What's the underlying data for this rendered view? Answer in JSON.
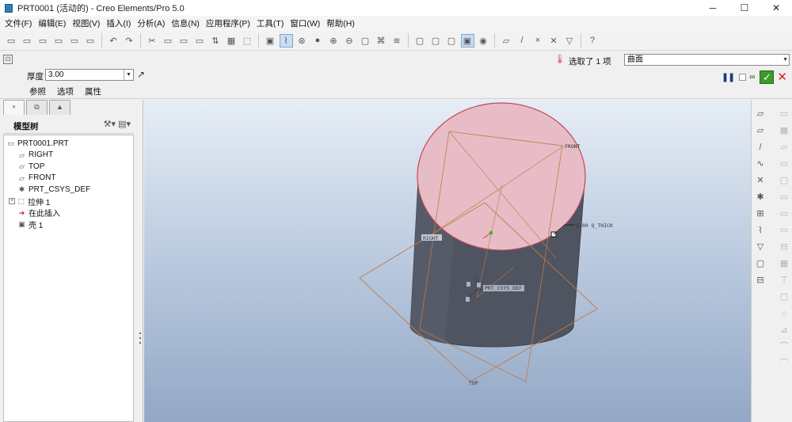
{
  "window": {
    "title": "PRT0001 (活动的) - Creo Elements/Pro 5.0",
    "minimize": "─",
    "maximize": "☐",
    "close": "✕"
  },
  "menu": [
    "文件(F)",
    "编辑(E)",
    "视图(V)",
    "插入(I)",
    "分析(A)",
    "信息(N)",
    "应用程序(P)",
    "工具(T)",
    "窗口(W)",
    "帮助(H)"
  ],
  "toolbar": {
    "icons": [
      "new-icon",
      "open-icon",
      "save-icon",
      "print-icon",
      "email-icon",
      "send-icon",
      "sep",
      "undo-icon",
      "redo-icon",
      "sep",
      "cut-icon",
      "copy-icon",
      "paste-icon",
      "paste-special-icon",
      "regenerate-icon",
      "find-icon",
      "select-box-icon",
      "sep",
      "datum-display-icon",
      "datum-axis-icon",
      "spin-center-icon",
      "appearance-icon",
      "zoom-in-icon",
      "zoom-out-icon",
      "refit-icon",
      "saved-views-icon",
      "layers-icon",
      "sep",
      "wireframe-icon",
      "hidden-line-icon",
      "no-hidden-icon",
      "shading-icon",
      "realtime-render-icon",
      "sep",
      "plane-display-icon",
      "axis-display-icon",
      "point-display-icon",
      "csys-display-icon",
      "annotation-display-icon",
      "sep",
      "context-help-icon"
    ],
    "glyphs": [
      "▭",
      "▭",
      "▭",
      "▭",
      "▭",
      "▭",
      "",
      "↶",
      "↷",
      "",
      "✂",
      "▭",
      "▭",
      "▭",
      "⇅",
      "▦",
      "⬚",
      "",
      "▣",
      "⌇",
      "⊛",
      "●",
      "⊕",
      "⊖",
      "▢",
      "⌘",
      "≋",
      "",
      "▢",
      "▢",
      "▢",
      "▣",
      "◉",
      "",
      "▱",
      "/",
      "×",
      "✕",
      "▽",
      "",
      "?"
    ]
  },
  "dashboard": {
    "thickness_label": "厚度",
    "thickness_value": "3.00",
    "flip": "↗",
    "tabs": [
      "参照",
      "选项",
      "属性"
    ],
    "selection_text": "选取了 1 项",
    "filter_value": "曲面",
    "pause": "❚❚",
    "glasses": "∞",
    "ok": "✓",
    "cancel": "✕"
  },
  "left_panel": {
    "tab_glyphs": [
      "⚬",
      "⧉",
      "▲"
    ],
    "tree_title": "模型树",
    "tree_tools": "⚒▾ ▤▾",
    "items": [
      {
        "label": "PRT0001.PRT",
        "glyph": "▭",
        "icon": "part-icon"
      },
      {
        "label": "RIGHT",
        "glyph": "▱",
        "icon": "datum-plane-icon"
      },
      {
        "label": "TOP",
        "glyph": "▱",
        "icon": "datum-plane-icon"
      },
      {
        "label": "FRONT",
        "glyph": "▱",
        "icon": "datum-plane-icon"
      },
      {
        "label": "PRT_CSYS_DEF",
        "glyph": "✱",
        "icon": "csys-icon"
      },
      {
        "label": "拉伸 1",
        "glyph": "⬚",
        "icon": "extrude-icon",
        "expandable": true
      },
      {
        "label": "在此插入",
        "glyph": "➔",
        "icon": "insert-here-icon"
      },
      {
        "label": "壳 1",
        "glyph": "▣",
        "icon": "shell-icon"
      }
    ]
  },
  "viewport": {
    "labels": {
      "front": "FRONT",
      "right": "RIGHT",
      "top": "TOP",
      "thick": "3.00 Q_THICK",
      "csys": "PRT_CSYS_DEF"
    },
    "colors": {
      "top_face": "#e7bcc7",
      "body": "#4e5460",
      "datum": "#c07a44"
    }
  },
  "right_toolbar": {
    "left": [
      "▱",
      "▱",
      "/",
      "∿",
      "✕",
      "✱",
      "⊞",
      "⌇",
      "▽",
      "▢",
      "⊟"
    ],
    "right": [
      "▭",
      "▦",
      "▱",
      "▭",
      "▢",
      "▭",
      "▭",
      "▭",
      "⊟",
      "▦",
      "⊤",
      "▢",
      "⌂",
      "⊿",
      "⌒",
      "⌒"
    ]
  }
}
